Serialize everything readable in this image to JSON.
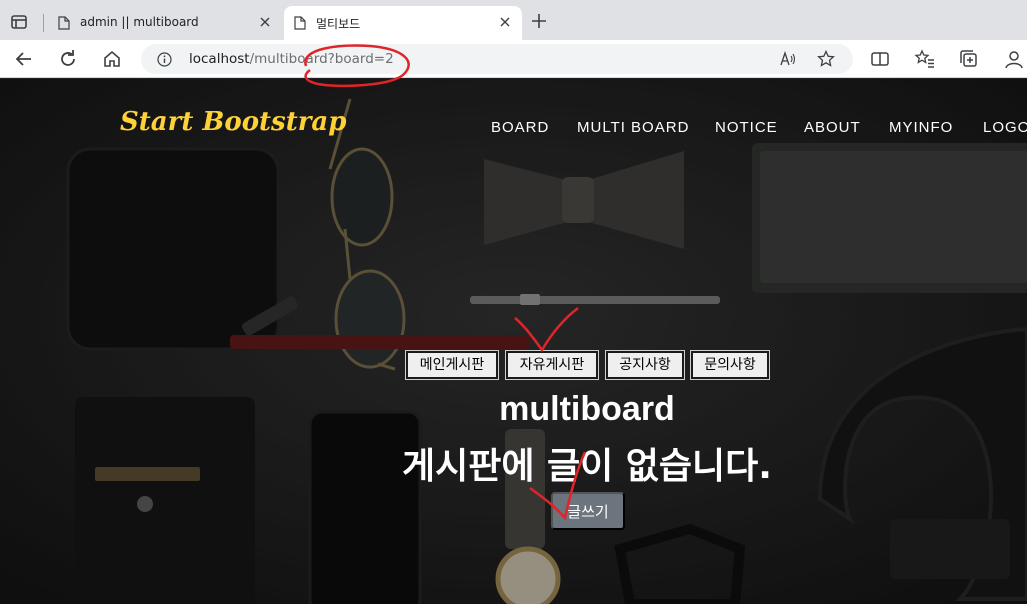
{
  "browser": {
    "tabs": [
      {
        "title": "admin || multiboard",
        "active": false
      },
      {
        "title": "멀티보드",
        "active": true
      }
    ],
    "address_bar": {
      "host": "localhost",
      "path": "/multiboard?board=2"
    }
  },
  "site": {
    "brand": "Start Bootstrap",
    "nav": [
      "BOARD",
      "MULTI BOARD",
      "NOTICE",
      "ABOUT",
      "MYINFO",
      "LOGO"
    ]
  },
  "board": {
    "buttons": [
      "메인게시판",
      "자유게시판",
      "공지사항",
      "문의사항"
    ],
    "heading": "multiboard",
    "empty_message": "게시판에 글이 없습니다.",
    "write_button": "글쓰기"
  },
  "colors": {
    "brand": "#fed136",
    "annotation": "#e0242a",
    "write_button": "#6c757d"
  }
}
